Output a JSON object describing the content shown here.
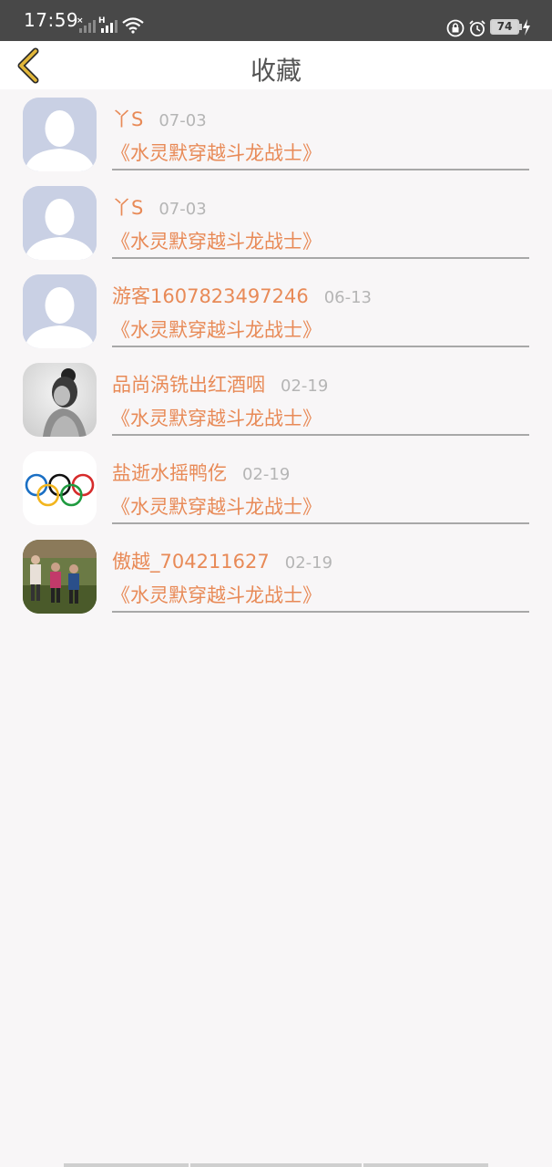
{
  "status_bar": {
    "time": "17:59",
    "battery": "74",
    "icons": [
      "signal-x-icon",
      "signal-h-icon",
      "wifi-icon",
      "lock-icon",
      "alarm-icon",
      "battery-icon",
      "charging-icon"
    ]
  },
  "header": {
    "back_icon": "chevron-left-icon",
    "title": "收藏"
  },
  "favorites": [
    {
      "user": "丫S",
      "date": "07-03",
      "book": "《水灵默穿越斗龙战士》",
      "avatar": "default-avatar"
    },
    {
      "user": "丫S",
      "date": "07-03",
      "book": "《水灵默穿越斗龙战士》",
      "avatar": "default-avatar"
    },
    {
      "user": "游客1607823497246",
      "date": "06-13",
      "book": "《水灵默穿越斗龙战士》",
      "avatar": "default-avatar"
    },
    {
      "user": "品尚涡铣出红酒咽",
      "date": "02-19",
      "book": "《水灵默穿越斗龙战士》",
      "avatar": "portrait-photo"
    },
    {
      "user": "盐逝水摇鸭仡",
      "date": "02-19",
      "book": "《水灵默穿越斗龙战士》",
      "avatar": "olympic-rings"
    },
    {
      "user": "傲越_704211627",
      "date": "02-19",
      "book": "《水灵默穿越斗龙战士》",
      "avatar": "field-photo"
    }
  ],
  "colors": {
    "accent": "#e88a57",
    "status_bar": "#484848",
    "back_icon": "#d4a82a",
    "date": "#b5b5b5"
  }
}
